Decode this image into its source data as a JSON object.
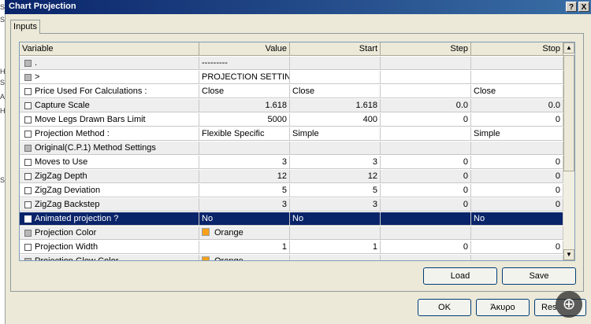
{
  "window": {
    "title": "Chart Projection",
    "help_glyph": "?",
    "close_glyph": "X"
  },
  "left_strip_letters": [
    "S",
    "S",
    "H",
    "S",
    "A",
    "H",
    "S"
  ],
  "tab": {
    "label": "Inputs"
  },
  "table": {
    "columns": [
      "Variable",
      "Value",
      "Start",
      "Step",
      "Stop"
    ],
    "rows": [
      {
        "label": ".",
        "value": "---------",
        "start": "",
        "step": "",
        "stop": "",
        "checkbox": "disabled",
        "style": "shaded",
        "numeric": false
      },
      {
        "label": ">",
        "value": "PROJECTION SETTINGS",
        "start": "",
        "step": "",
        "stop": "",
        "checkbox": "disabled",
        "style": "",
        "numeric": false
      },
      {
        "label": "Price Used For Calculations :",
        "value": "Close",
        "start": "Close",
        "step": "",
        "stop": "Close",
        "checkbox": "enabled",
        "style": "",
        "numeric": false
      },
      {
        "label": "Capture Scale",
        "value": "1.618",
        "start": "1.618",
        "step": "0.0",
        "stop": "0.0",
        "checkbox": "enabled",
        "style": "shaded",
        "numeric": true
      },
      {
        "label": "Move Legs Drawn Bars Limit",
        "value": "5000",
        "start": "400",
        "step": "0",
        "stop": "0",
        "checkbox": "enabled",
        "style": "",
        "numeric": true
      },
      {
        "label": "Projection Method :",
        "value": "Flexible Specific",
        "start": "Simple",
        "step": "",
        "stop": "Simple",
        "checkbox": "enabled",
        "style": "",
        "numeric": false
      },
      {
        "label": "Original(C.P.1) Method Settings",
        "value": "",
        "start": "",
        "step": "",
        "stop": "",
        "checkbox": "disabled",
        "style": "shaded",
        "numeric": false
      },
      {
        "label": "Moves to Use",
        "value": "3",
        "start": "3",
        "step": "0",
        "stop": "0",
        "checkbox": "enabled",
        "style": "",
        "numeric": true
      },
      {
        "label": "ZigZag Depth",
        "value": "12",
        "start": "12",
        "step": "0",
        "stop": "0",
        "checkbox": "enabled",
        "style": "shaded",
        "numeric": true
      },
      {
        "label": "ZigZag Deviation",
        "value": "5",
        "start": "5",
        "step": "0",
        "stop": "0",
        "checkbox": "enabled",
        "style": "",
        "numeric": true
      },
      {
        "label": "ZigZag Backstep",
        "value": "3",
        "start": "3",
        "step": "0",
        "stop": "0",
        "checkbox": "enabled",
        "style": "shaded",
        "numeric": true
      },
      {
        "label": "Animated projection ?",
        "value": "No",
        "start": "No",
        "step": "",
        "stop": "No",
        "checkbox": "enabled",
        "style": "selected",
        "numeric": false
      },
      {
        "label": "Projection Color",
        "value": "Orange",
        "start": "",
        "step": "",
        "stop": "",
        "checkbox": "disabled",
        "style": "shaded",
        "numeric": false,
        "swatch": "#f5a11a"
      },
      {
        "label": "Projection Width",
        "value": "1",
        "start": "1",
        "step": "0",
        "stop": "0",
        "checkbox": "enabled",
        "style": "",
        "numeric": true
      },
      {
        "label": "Projection Glow Color",
        "value": "Orange",
        "start": "",
        "step": "",
        "stop": "",
        "checkbox": "disabled",
        "style": "shaded",
        "numeric": false,
        "swatch": "#f5a11a"
      }
    ]
  },
  "buttons": {
    "load": "Load",
    "save": "Save",
    "ok": "OK",
    "cancel": "Άκυρο",
    "reset": "Res"
  },
  "icons": {
    "scroll_up": "scroll-up-icon",
    "scroll_down": "scroll-down-icon",
    "zoom": "zoom-in-icon"
  },
  "colors": {
    "title_bar": "#0a246a",
    "selection": "#0a246a",
    "swatch": "#f5a11a"
  }
}
